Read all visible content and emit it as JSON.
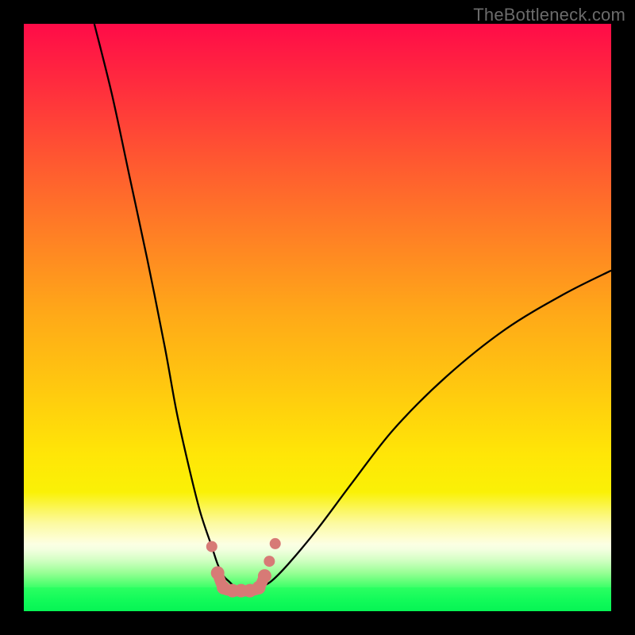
{
  "watermark": "TheBottleneck.com",
  "chart_data": {
    "type": "line",
    "title": "",
    "xlabel": "",
    "ylabel": "",
    "xlim": [
      0,
      100
    ],
    "ylim": [
      0,
      100
    ],
    "description": "Two black curves descending from the top-left and top-right edges, meeting near the bottom center where a salmon-colored U-shaped marker band sits. Background is a vertical heat gradient from red (top) through orange and yellow to pale near-white, then thin green bands and a bright green strip at the very bottom.",
    "series": [
      {
        "name": "left-curve",
        "x": [
          12,
          15,
          18,
          21,
          24,
          26,
          28,
          30,
          32,
          33,
          34,
          35,
          36
        ],
        "y": [
          100,
          88,
          74,
          60,
          45,
          34,
          25,
          17,
          11,
          8,
          6,
          5,
          4
        ]
      },
      {
        "name": "right-curve",
        "x": [
          40,
          42,
          45,
          50,
          56,
          63,
          72,
          82,
          92,
          100
        ],
        "y": [
          4,
          5,
          8,
          14,
          22,
          31,
          40,
          48,
          54,
          58
        ]
      }
    ],
    "markers": {
      "name": "valley-dots",
      "color": "#d77a76",
      "points": [
        {
          "x": 32.0,
          "y": 11.0
        },
        {
          "x": 33.0,
          "y": 6.5
        },
        {
          "x": 34.0,
          "y": 4.0
        },
        {
          "x": 35.5,
          "y": 3.5
        },
        {
          "x": 37.0,
          "y": 3.5
        },
        {
          "x": 38.5,
          "y": 3.5
        },
        {
          "x": 40.0,
          "y": 4.0
        },
        {
          "x": 41.0,
          "y": 6.0
        },
        {
          "x": 41.8,
          "y": 8.5
        },
        {
          "x": 42.8,
          "y": 11.5
        }
      ]
    },
    "gradient_stops": [
      {
        "pos": 0.0,
        "color": "#ff0b48"
      },
      {
        "pos": 0.3,
        "color": "#ff7a28"
      },
      {
        "pos": 0.6,
        "color": "#ffd60a"
      },
      {
        "pos": 0.8,
        "color": "#faf106"
      },
      {
        "pos": 0.88,
        "color": "#fcfcbe"
      },
      {
        "pos": 0.93,
        "color": "#c9ffb8"
      },
      {
        "pos": 0.97,
        "color": "#55ff74"
      },
      {
        "pos": 1.0,
        "color": "#06f454"
      }
    ]
  }
}
